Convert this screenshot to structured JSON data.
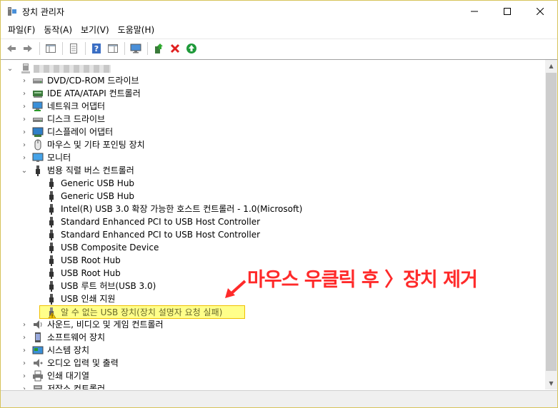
{
  "window": {
    "title": "장치 관리자"
  },
  "menu": {
    "items": [
      "파일(F)",
      "동작(A)",
      "보기(V)",
      "도움말(H)"
    ]
  },
  "tree": {
    "computer_name": "",
    "categories": [
      {
        "label": "DVD/CD-ROM 드라이브",
        "icon": "dvd-drive-icon",
        "expanded": false
      },
      {
        "label": "IDE ATA/ATAPI 컨트롤러",
        "icon": "ide-controller-icon",
        "expanded": false
      },
      {
        "label": "네트워크 어댑터",
        "icon": "network-adapter-icon",
        "expanded": false
      },
      {
        "label": "디스크 드라이브",
        "icon": "disk-drive-icon",
        "expanded": false
      },
      {
        "label": "디스플레이 어댑터",
        "icon": "display-adapter-icon",
        "expanded": false
      },
      {
        "label": "마우스 및 기타 포인팅 장치",
        "icon": "mouse-icon",
        "expanded": false
      },
      {
        "label": "모니터",
        "icon": "monitor-icon",
        "expanded": false
      },
      {
        "label": "범용 직렬 버스 컨트롤러",
        "icon": "usb-icon",
        "expanded": true
      }
    ],
    "usb_children": [
      "Generic USB Hub",
      "Generic USB Hub",
      "Intel(R) USB 3.0 확장 가능한 호스트 컨트롤러 - 1.0(Microsoft)",
      "Standard Enhanced PCI to USB Host Controller",
      "Standard Enhanced PCI to USB Host Controller",
      "USB Composite Device",
      "USB Root Hub",
      "USB Root Hub",
      "USB 루트 허브(USB 3.0)",
      "USB 인쇄 지원",
      "알 수 없는 USB 장치(장치 설명자 요청 실패)"
    ],
    "after_categories": [
      {
        "label": "사운드, 비디오 및 게임 컨트롤러",
        "icon": "sound-icon"
      },
      {
        "label": "소프트웨어 장치",
        "icon": "software-device-icon"
      },
      {
        "label": "시스템 장치",
        "icon": "system-device-icon"
      },
      {
        "label": "오디오 입력 및 출력",
        "icon": "audio-io-icon"
      },
      {
        "label": "인쇄 대기열",
        "icon": "print-queue-icon"
      },
      {
        "label": "저장소 컨트롤러",
        "icon": "storage-controller-icon"
      }
    ]
  },
  "annotation": {
    "text": "마우스 우클릭 후 〉장치 제거",
    "color": "#ff2a2a"
  },
  "colors": {
    "highlight_fill": "#ffff8a",
    "highlight_border": "#f0c000",
    "window_border": "#d6c35a"
  }
}
